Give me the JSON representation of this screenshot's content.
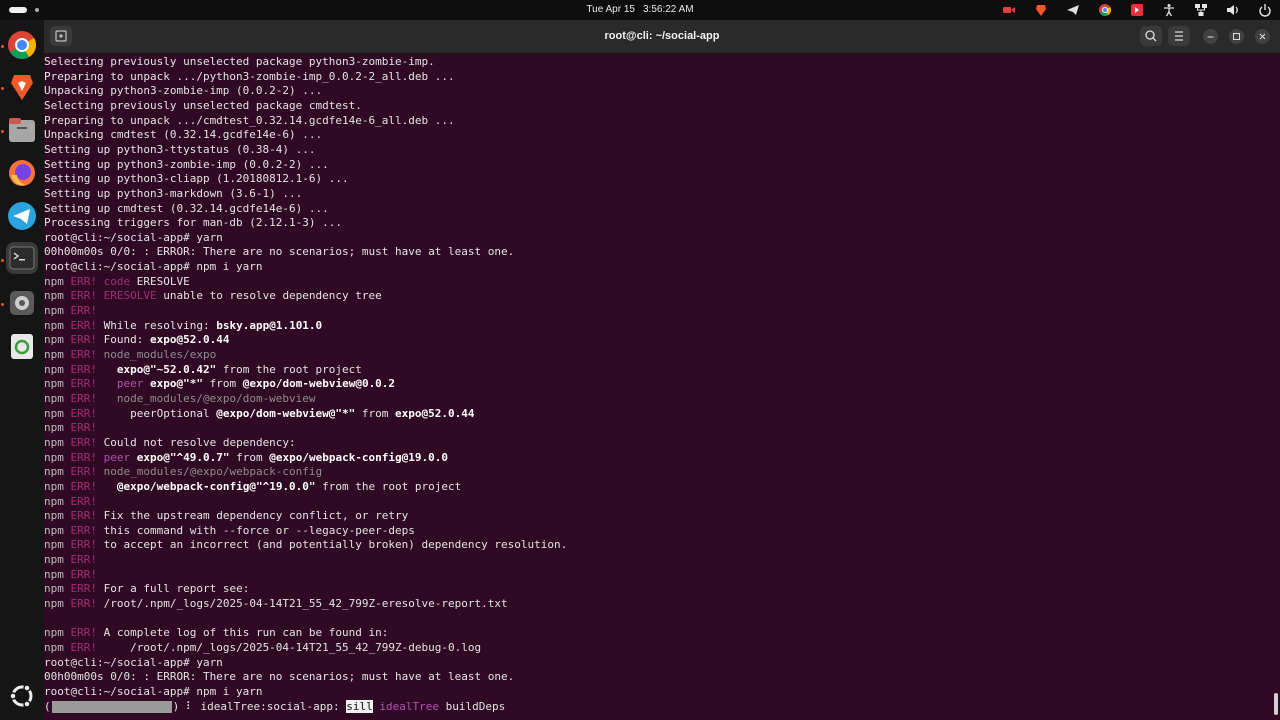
{
  "topbar": {
    "date": "Tue Apr 15",
    "time": "3:56:22 AM"
  },
  "window": {
    "title": "root@cli: ~/social-app"
  },
  "dock_icons": [
    "chrome-icon",
    "brave-icon",
    "files-icon",
    "firefox-icon",
    "telegram-icon",
    "terminal-icon",
    "settings-icon",
    "trash-icon",
    "ubuntu-apps-icon"
  ],
  "tray_icons": [
    "screen-record-icon",
    "brave-tray-icon",
    "telegram-tray-icon",
    "chrome-tray-icon",
    "anydesk-icon",
    "accessibility-icon",
    "network-icon",
    "volume-icon",
    "power-icon"
  ],
  "colors": {
    "terminal_bg": "#300a24",
    "err": "#a32d77",
    "peer": "#b152b3"
  },
  "terminal": {
    "lines": [
      {
        "text": "Selecting previously unselected package python3-zombie-imp."
      },
      {
        "text": "Preparing to unpack .../python3-zombie-imp_0.0.2-2_all.deb ..."
      },
      {
        "text": "Unpacking python3-zombie-imp (0.0.2-2) ..."
      },
      {
        "text": "Selecting previously unselected package cmdtest."
      },
      {
        "text": "Preparing to unpack .../cmdtest_0.32.14.gcdfe14e-6_all.deb ..."
      },
      {
        "text": "Unpacking cmdtest (0.32.14.gcdfe14e-6) ..."
      },
      {
        "text": "Setting up python3-ttystatus (0.38-4) ..."
      },
      {
        "text": "Setting up python3-zombie-imp (0.0.2-2) ..."
      },
      {
        "text": "Setting up python3-cliapp (1.20180812.1-6) ..."
      },
      {
        "text": "Setting up python3-markdown (3.6-1) ..."
      },
      {
        "text": "Setting up cmdtest (0.32.14.gcdfe14e-6) ..."
      },
      {
        "text": "Processing triggers for man-db (2.12.1-3) ..."
      },
      {
        "text": "root@cli:~/social-app# yarn"
      },
      {
        "text": "00h00m00s 0/0: : ERROR: There are no scenarios; must have at least one."
      },
      {
        "text": "root@cli:~/social-app# npm i yarn"
      },
      {
        "text": "npm ERR! code ERESOLVE"
      },
      {
        "text": "npm ERR! ERESOLVE unable to resolve dependency tree"
      },
      {
        "text": "npm ERR!"
      },
      {
        "text": "npm ERR! While resolving: bsky.app@1.101.0"
      },
      {
        "text": "npm ERR! Found: expo@52.0.44"
      },
      {
        "text": "npm ERR! node_modules/expo"
      },
      {
        "text": "npm ERR!   expo@\"~52.0.42\" from the root project"
      },
      {
        "text": "npm ERR!   peer expo@\"*\" from @expo/dom-webview@0.0.2"
      },
      {
        "text": "npm ERR!   node_modules/@expo/dom-webview"
      },
      {
        "text": "npm ERR!     peerOptional @expo/dom-webview@\"*\" from expo@52.0.44"
      },
      {
        "text": "npm ERR!"
      },
      {
        "text": "npm ERR! Could not resolve dependency:"
      },
      {
        "text": "npm ERR! peer expo@\"^49.0.7\" from @expo/webpack-config@19.0.0"
      },
      {
        "text": "npm ERR! node_modules/@expo/webpack-config"
      },
      {
        "text": "npm ERR!   @expo/webpack-config@\"^19.0.0\" from the root project"
      },
      {
        "text": "npm ERR!"
      },
      {
        "text": "npm ERR! Fix the upstream dependency conflict, or retry"
      },
      {
        "text": "npm ERR! this command with --force or --legacy-peer-deps"
      },
      {
        "text": "npm ERR! to accept an incorrect (and potentially broken) dependency resolution."
      },
      {
        "text": "npm ERR!"
      },
      {
        "text": "npm ERR!"
      },
      {
        "text": "npm ERR! For a full report see:"
      },
      {
        "text": "npm ERR! /root/.npm/_logs/2025-04-14T21_55_42_799Z-eresolve-report.txt"
      },
      {
        "text": ""
      },
      {
        "text": "npm ERR! A complete log of this run can be found in:"
      },
      {
        "text": "npm ERR!     /root/.npm/_logs/2025-04-14T21_55_42_799Z-debug-0.log"
      },
      {
        "text": "root@cli:~/social-app# yarn"
      },
      {
        "text": "00h00m00s 0/0: : ERROR: There are no scenarios; must have at least one."
      },
      {
        "text": "root@cli:~/social-app# npm i yarn"
      },
      {
        "text": "(                  ) ⠇ idealTree:social-app: sill idealTree buildDeps"
      }
    ]
  }
}
